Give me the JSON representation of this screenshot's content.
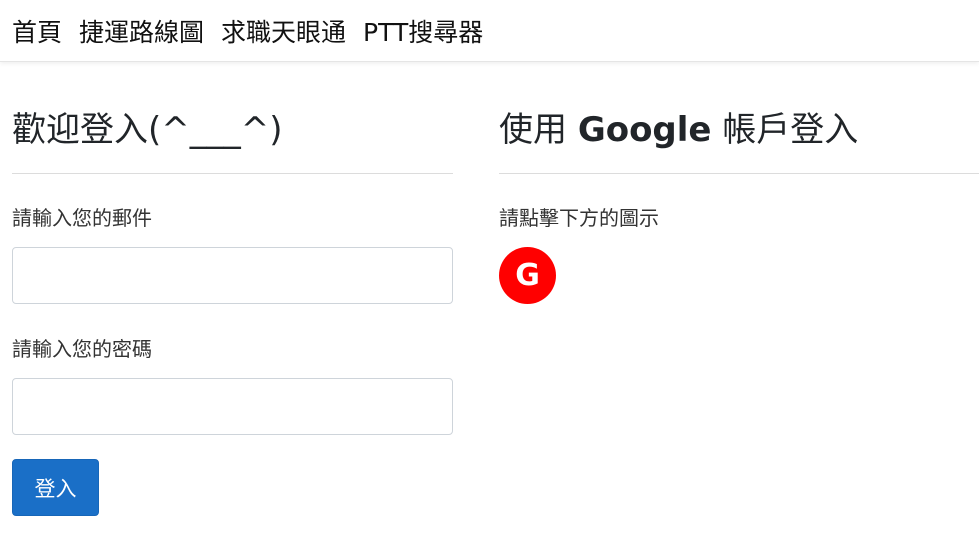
{
  "nav": {
    "items": [
      "首頁",
      "捷運路線圖",
      "求職天眼通",
      "PTT搜尋器"
    ]
  },
  "login": {
    "title": "歡迎登入(^___^)",
    "email_label": "請輸入您的郵件",
    "email_value": "",
    "password_label": "請輸入您的密碼",
    "password_value": "",
    "submit_label": "登入"
  },
  "google": {
    "title_prefix": "使用",
    "title_brand": "Google",
    "title_suffix": "帳戶登入",
    "hint": "請點擊下方的圖示",
    "icon_letter": "G",
    "icon_color": "#ff0000"
  },
  "colors": {
    "primary_button": "#1a6fc7"
  }
}
